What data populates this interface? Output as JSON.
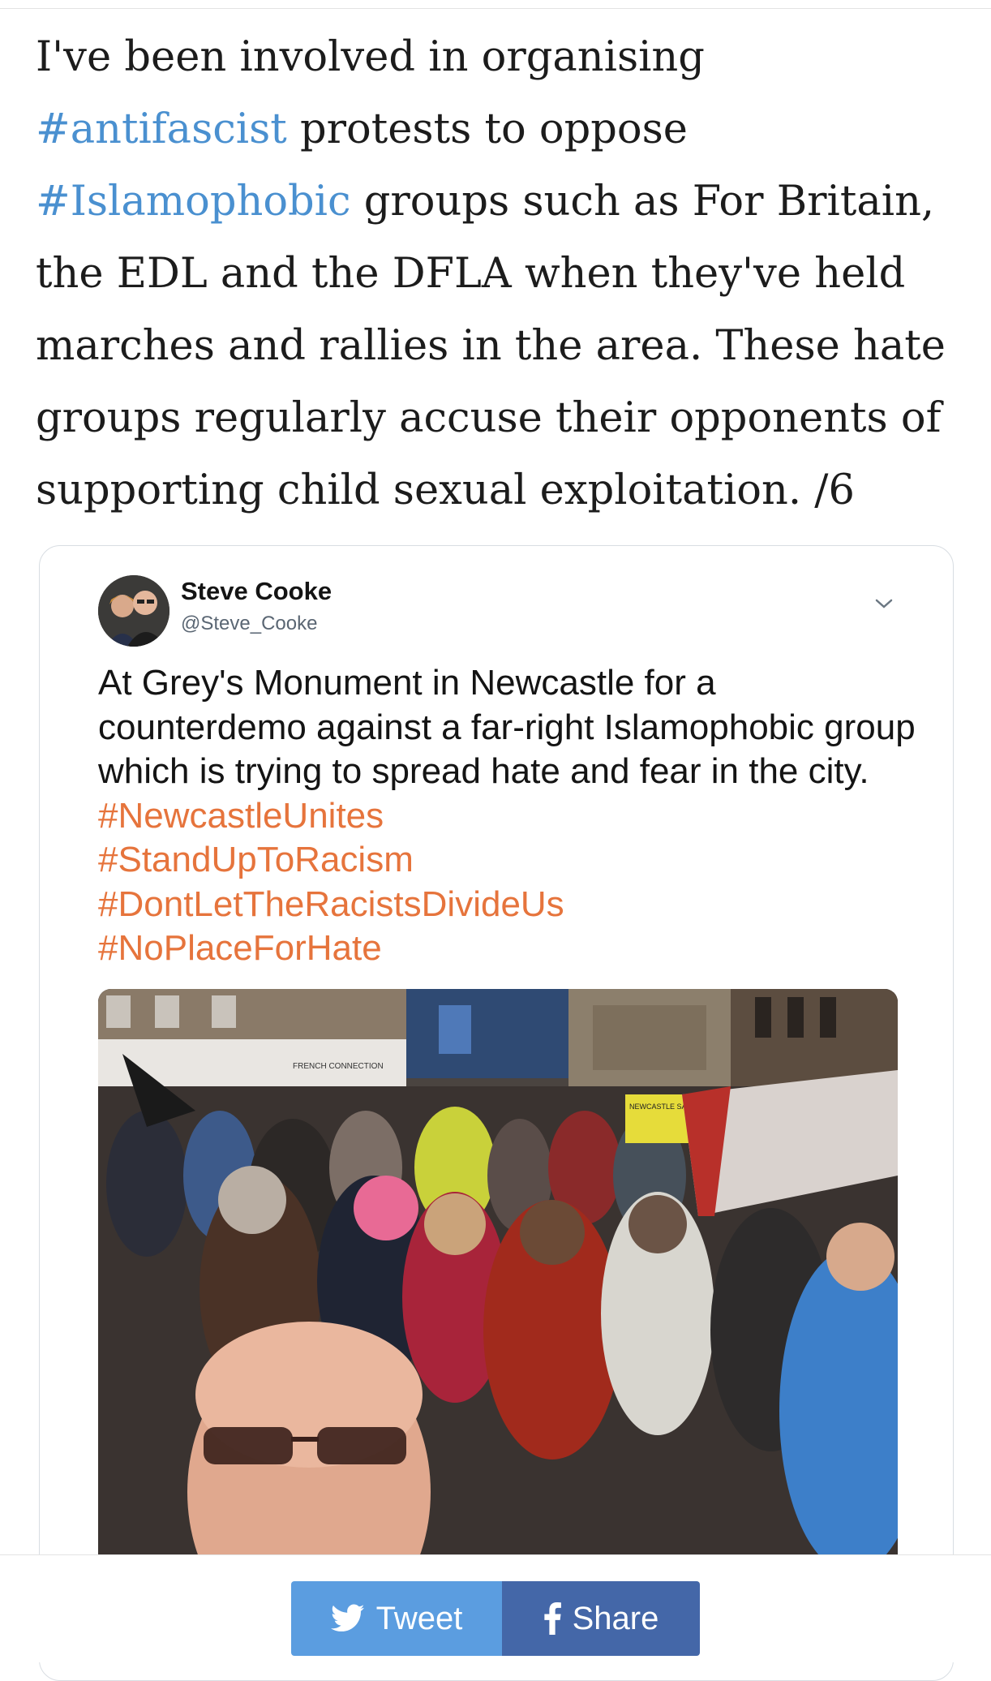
{
  "article": {
    "text_before_1": "I've been involved in organising ",
    "hashtag_1": "#antifascist",
    "text_between_1": " protests to oppose ",
    "hashtag_2": "#Islamophobic",
    "text_after": " groups such as For Britain, the EDL and the DFLA when they've held marches and rallies in the area. These hate groups regularly accuse their opponents of supporting child sexual exploitation. /6"
  },
  "embedded_tweet": {
    "author_name": "Steve Cooke",
    "author_handle": "@Steve_Cooke",
    "text": "At Grey's Monument in Newcastle for a counterdemo against a far-right Islamophobic group which is trying to spread hate and fear in the city. ",
    "hashtags": [
      "#NewcastleUnites",
      "#StandUpToRacism",
      "#DontLetTheRacistsDivideUs",
      "#NoPlaceForHate"
    ],
    "photo_sign_text": "NEWCASTLE SAY NO TO RACISM AND ISLAMOPHOBIA",
    "photo_shop_sign": "FRENCH CONNECTION"
  },
  "share_bar": {
    "tweet_label": "Tweet",
    "share_label": "Share"
  },
  "colors": {
    "link_blue": "#4a90d0",
    "hashtag_orange": "#e6743c",
    "tweet_button": "#5b9de0",
    "share_button": "#4467a8"
  },
  "icons": [
    "chevron-down-icon",
    "twitter-bird-icon",
    "facebook-f-icon"
  ]
}
